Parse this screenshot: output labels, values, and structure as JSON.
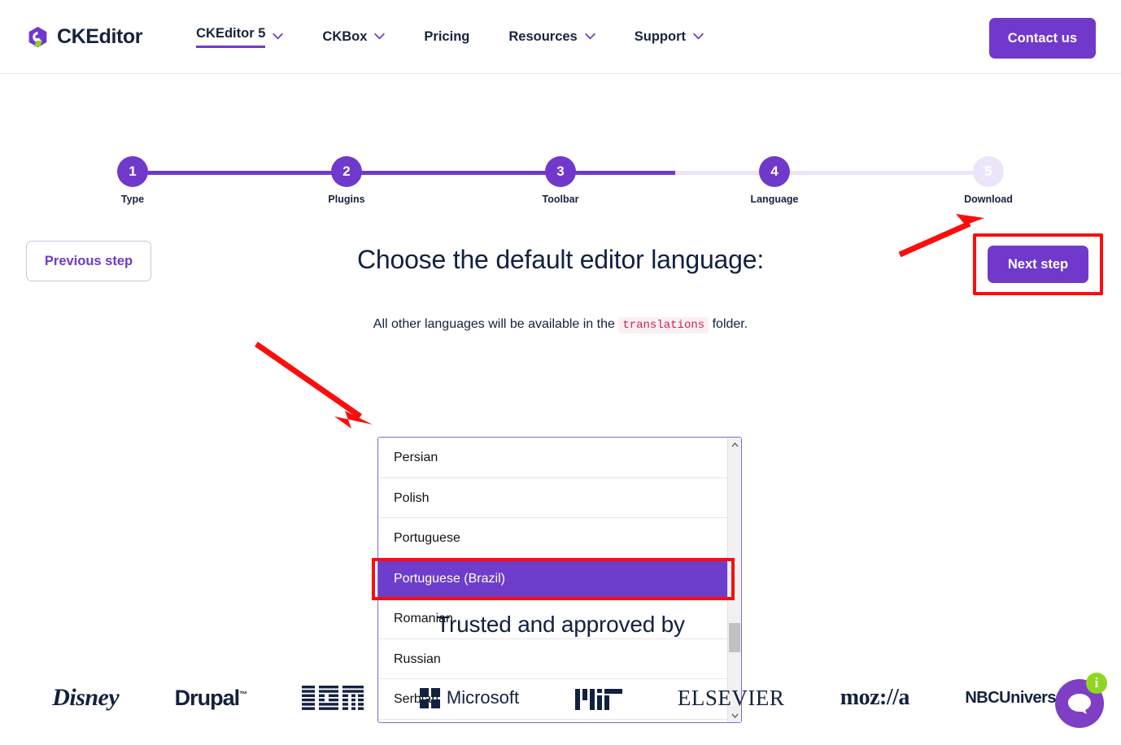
{
  "nav": {
    "brand": "CKEditor",
    "items": [
      {
        "label": "CKEditor 5",
        "has_caret": true,
        "active": true
      },
      {
        "label": "CKBox",
        "has_caret": true,
        "active": false
      },
      {
        "label": "Pricing",
        "has_caret": false,
        "active": false
      },
      {
        "label": "Resources",
        "has_caret": true,
        "active": false
      },
      {
        "label": "Support",
        "has_caret": true,
        "active": false
      }
    ],
    "contact_label": "Contact us"
  },
  "stepper": {
    "steps": [
      {
        "number": "1",
        "label": "Type",
        "state": "done"
      },
      {
        "number": "2",
        "label": "Plugins",
        "state": "done"
      },
      {
        "number": "3",
        "label": "Toolbar",
        "state": "done"
      },
      {
        "number": "4",
        "label": "Language",
        "state": "current"
      },
      {
        "number": "5",
        "label": "Download",
        "state": "inactive"
      }
    ],
    "active_color": "#7039cc",
    "inactive_color": "#ece4f9"
  },
  "main": {
    "previous_label": "Previous step",
    "next_label": "Next step",
    "title": "Choose the default editor language:",
    "subtitle_before": "All other languages will be available in the",
    "subtitle_code": "translations",
    "subtitle_after": "folder."
  },
  "language_list": {
    "items": [
      {
        "label": "Persian",
        "selected": false
      },
      {
        "label": "Polish",
        "selected": false
      },
      {
        "label": "Portuguese",
        "selected": false
      },
      {
        "label": "Portuguese (Brazil)",
        "selected": true
      },
      {
        "label": "Romanian",
        "selected": false
      },
      {
        "label": "Russian",
        "selected": false
      },
      {
        "label": "Serbian",
        "selected": false
      }
    ],
    "selected_value": "Portuguese (Brazil)",
    "selected_color": "#6f3dcb",
    "scroll_up_icon": "chevron-up-icon",
    "scroll_down_icon": "chevron-down-icon"
  },
  "trusted": {
    "title": "Trusted and approved by",
    "logos": [
      {
        "name": "disney",
        "text": "Disney"
      },
      {
        "name": "drupal",
        "text": "Drupal"
      },
      {
        "name": "ibm",
        "text": "IBM"
      },
      {
        "name": "microsoft",
        "text": "Microsoft"
      },
      {
        "name": "mit",
        "text": "MIT"
      },
      {
        "name": "elsevier",
        "text": "ELSEVIER"
      },
      {
        "name": "mozilla",
        "text": "moz://a"
      },
      {
        "name": "nbcuniversal",
        "text": "NBCUniversal"
      }
    ]
  },
  "chat": {
    "icon": "chat-bubble-icon",
    "badge": "i",
    "badge_color": "#8fd622",
    "circle_color": "#7e3fc4"
  },
  "annotations": {
    "highlight_color": "#fc0d0d",
    "boxes": [
      "next-step-button",
      "selected-language-item"
    ],
    "arrows": [
      "arrow-to-next-step",
      "arrow-to-selected-language"
    ]
  }
}
